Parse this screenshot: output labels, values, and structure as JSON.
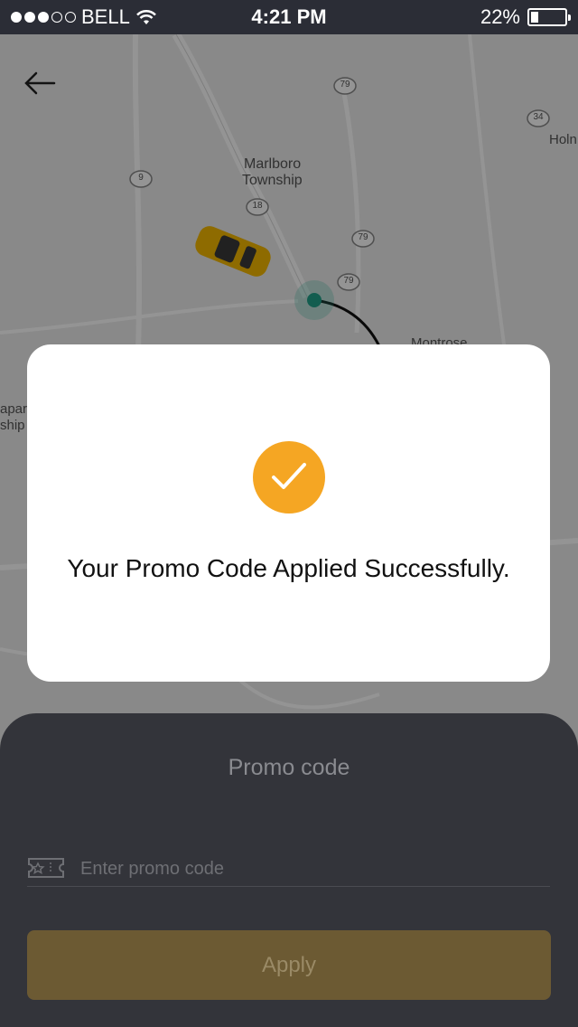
{
  "status_bar": {
    "carrier": "BELL",
    "time": "4:21 PM",
    "battery_percent": "22%",
    "signal_bars_filled": 3,
    "signal_bars_total": 5
  },
  "map": {
    "labels": {
      "marlboro": "Marlboro",
      "township": "Township",
      "montrose": "Montrose",
      "holm_partial": "Holn",
      "left_partial_1": "apar",
      "left_partial_2": "ship"
    },
    "route_shields": [
      "79",
      "34",
      "9",
      "18",
      "79",
      "79"
    ]
  },
  "modal": {
    "message": "Your Promo Code Applied Successfully.",
    "icon": "check-icon",
    "accent_color": "#f5a623"
  },
  "promo_sheet": {
    "title": "Promo code",
    "input_placeholder": "Enter promo code",
    "input_value": "",
    "apply_label": "Apply"
  }
}
